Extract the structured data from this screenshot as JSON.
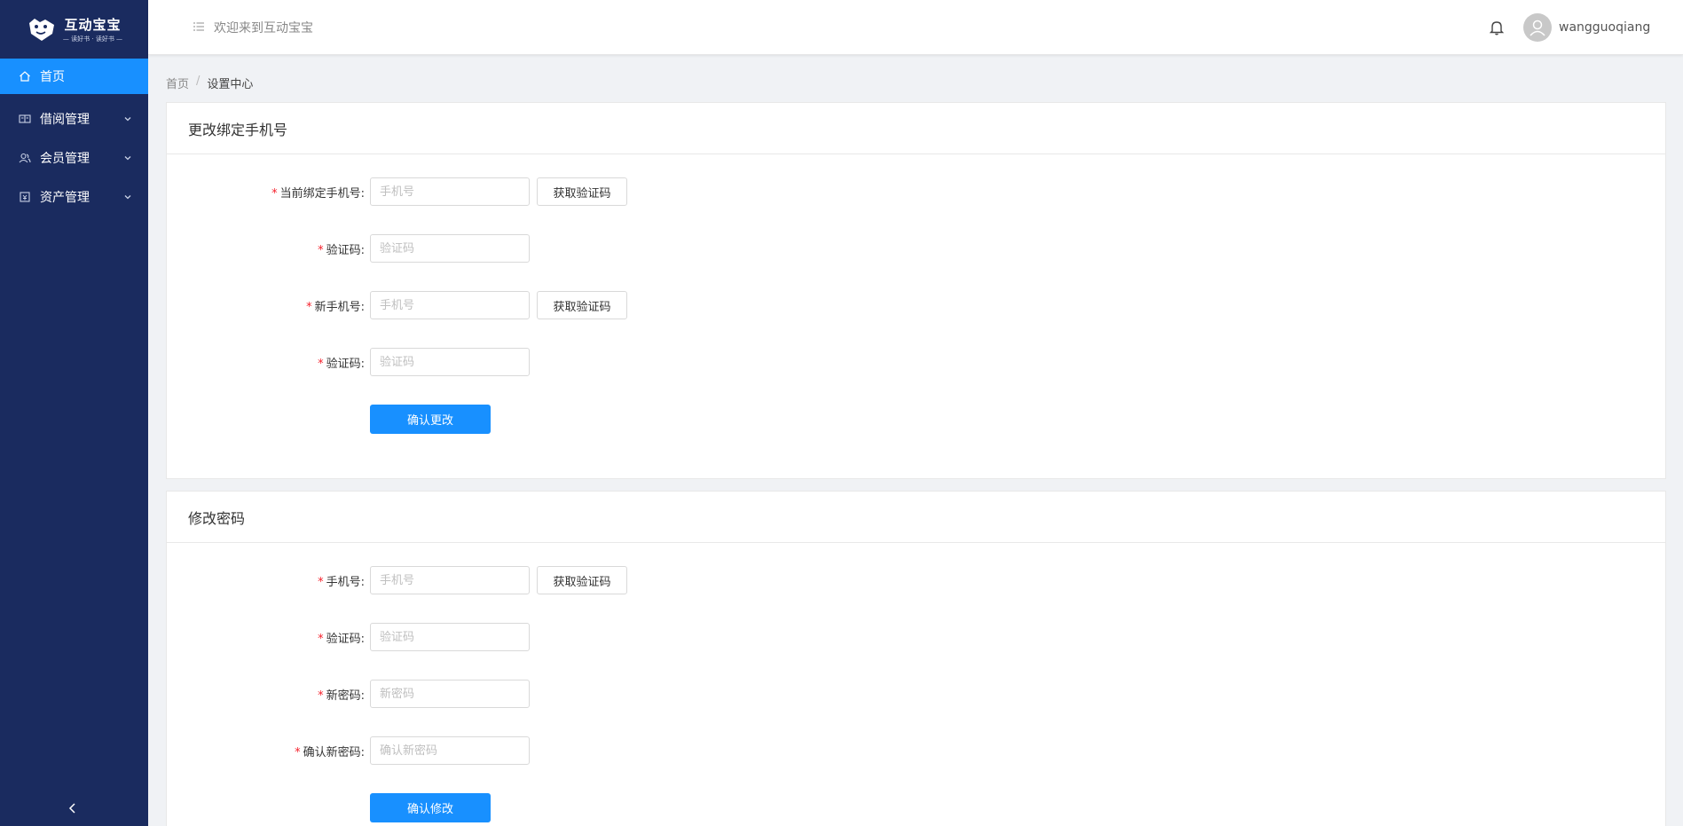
{
  "brand": {
    "title": "互动宝宝",
    "slogan": "— 读好书 · 读好书 —"
  },
  "sidebar": {
    "items": [
      {
        "label": "首页",
        "icon": "home-icon",
        "active": true
      },
      {
        "label": "借阅管理",
        "icon": "book-icon",
        "active": false
      },
      {
        "label": "会员管理",
        "icon": "users-icon",
        "active": false
      },
      {
        "label": "资产管理",
        "icon": "asset-icon",
        "active": false
      }
    ]
  },
  "header": {
    "welcome": "欢迎来到互动宝宝",
    "username": "wangguoqiang"
  },
  "breadcrumb": {
    "home": "首页",
    "separator": "/",
    "current": "设置中心"
  },
  "phone_card": {
    "title": "更改绑定手机号",
    "current_phone": {
      "label": "当前绑定手机号:",
      "placeholder": "手机号",
      "value": ""
    },
    "current_code": {
      "label": "验证码:",
      "placeholder": "验证码",
      "value": ""
    },
    "new_phone": {
      "label": "新手机号:",
      "placeholder": "手机号",
      "value": ""
    },
    "new_code": {
      "label": "验证码:",
      "placeholder": "验证码",
      "value": ""
    },
    "get_code_label": "获取验证码",
    "submit_label": "确认更改"
  },
  "password_card": {
    "title": "修改密码",
    "phone": {
      "label": "手机号:",
      "placeholder": "手机号",
      "value": ""
    },
    "code": {
      "label": "验证码:",
      "placeholder": "验证码",
      "value": ""
    },
    "new_password": {
      "label": "新密码:",
      "placeholder": "新密码",
      "value": ""
    },
    "confirm_password": {
      "label": "确认新密码:",
      "placeholder": "确认新密码",
      "value": ""
    },
    "get_code_label": "获取验证码",
    "submit_label": "确认修改"
  },
  "colors": {
    "sidebar_bg": "#1a2b5f",
    "accent": "#1890ff",
    "required": "#f5222d"
  }
}
